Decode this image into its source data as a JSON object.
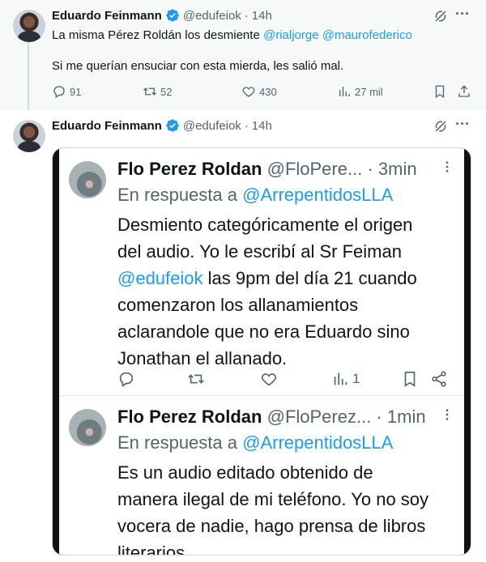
{
  "tweet1": {
    "author_name": "Eduardo Feinmann",
    "handle": "@edufeiok",
    "separator": "·",
    "time": "14h",
    "text_prefix": "La misma Pérez Roldán los desmiente ",
    "mentions": [
      "@rialjorge",
      "@maurofederico"
    ],
    "text_line2": "Si me querían ensuciar con esta mierda, les salió mal.",
    "replies": "91",
    "retweets": "52",
    "likes": "430",
    "views": "27 mil"
  },
  "tweet2": {
    "author_name": "Eduardo Feinmann",
    "handle": "@edufeiok",
    "separator": "·",
    "time": "14h"
  },
  "screenshot": {
    "post1": {
      "name": "Flo Perez Roldan",
      "handle": "@FloPere...",
      "separator": "·",
      "time": "3min",
      "reply_prefix": "En respuesta a ",
      "reply_to": "@ArrepentidosLLA",
      "body_lines": [
        "Desmiento categóricamente el origen",
        "del audio. Yo le escribí al Sr Feiman",
        "las 9pm del día 21 cuando",
        "comenzaron los allanamientos",
        "aclarandole que no era Eduardo sino",
        "Jonathan el allanado."
      ],
      "body_mention": "@edufeiok",
      "views": "1"
    },
    "post2": {
      "name": "Flo Perez Roldan",
      "handle": "@FloPerez...",
      "separator": "·",
      "time": "1min",
      "reply_prefix": "En respuesta a ",
      "reply_to": "@ArrepentidosLLA",
      "body_lines": [
        "Es un audio editado obtenido de",
        "manera ilegal de mi teléfono. Yo no soy",
        "vocera de nadie, hago prensa de libros",
        "literarios"
      ]
    }
  },
  "colors": {
    "accent": "#1d9bf0",
    "muted": "#536471",
    "text": "#0f1419"
  },
  "icons": [
    "verified-badge-icon",
    "grok-icon",
    "more-icon",
    "reply-icon",
    "retweet-icon",
    "like-icon",
    "views-icon",
    "bookmark-icon",
    "share-icon"
  ]
}
